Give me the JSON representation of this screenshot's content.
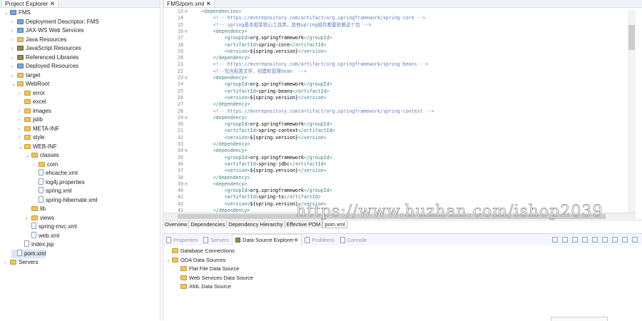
{
  "project_explorer": {
    "tab_label": "Project Explorer",
    "items": [
      {
        "label": "FMS",
        "depth": 0,
        "twisty": "open",
        "icon": "proj"
      },
      {
        "label": "Deployment Descriptor: FMS",
        "depth": 1,
        "twisty": "closed",
        "icon": "proj"
      },
      {
        "label": "JAX-WS Web Services",
        "depth": 1,
        "twisty": "closed",
        "icon": "proj"
      },
      {
        "label": "Java Resources",
        "depth": 1,
        "twisty": "closed",
        "icon": "folder"
      },
      {
        "label": "JavaScript Resources",
        "depth": 1,
        "twisty": "closed",
        "icon": "lib"
      },
      {
        "label": "Referenced Libraries",
        "depth": 1,
        "twisty": "closed",
        "icon": "lib"
      },
      {
        "label": "Deployed Resources",
        "depth": 1,
        "twisty": "closed",
        "icon": "proj"
      },
      {
        "label": "target",
        "depth": 1,
        "twisty": "closed",
        "icon": "folder"
      },
      {
        "label": "WebRoot",
        "depth": 1,
        "twisty": "open",
        "icon": "folder"
      },
      {
        "label": "error",
        "depth": 2,
        "twisty": "closed",
        "icon": "folder"
      },
      {
        "label": "excel",
        "depth": 2,
        "twisty": "",
        "icon": "folder"
      },
      {
        "label": "images",
        "depth": 2,
        "twisty": "closed",
        "icon": "folder"
      },
      {
        "label": "jslib",
        "depth": 2,
        "twisty": "closed",
        "icon": "folder"
      },
      {
        "label": "META-INF",
        "depth": 2,
        "twisty": "closed",
        "icon": "folder"
      },
      {
        "label": "style",
        "depth": 2,
        "twisty": "closed",
        "icon": "folder"
      },
      {
        "label": "WEB-INF",
        "depth": 2,
        "twisty": "open",
        "icon": "folder"
      },
      {
        "label": "classes",
        "depth": 3,
        "twisty": "open",
        "icon": "folder"
      },
      {
        "label": "com",
        "depth": 4,
        "twisty": "closed",
        "icon": "folder"
      },
      {
        "label": "ehcache.xml",
        "depth": 4,
        "twisty": "",
        "icon": "file"
      },
      {
        "label": "log4j.properties",
        "depth": 4,
        "twisty": "",
        "icon": "file"
      },
      {
        "label": "spring.xml",
        "depth": 4,
        "twisty": "",
        "icon": "file"
      },
      {
        "label": "spring-hibernate.xml",
        "depth": 4,
        "twisty": "",
        "icon": "file"
      },
      {
        "label": "lib",
        "depth": 3,
        "twisty": "",
        "icon": "folder"
      },
      {
        "label": "views",
        "depth": 3,
        "twisty": "closed",
        "icon": "folder"
      },
      {
        "label": "spring-mvc.xml",
        "depth": 3,
        "twisty": "",
        "icon": "file"
      },
      {
        "label": "web.xml",
        "depth": 3,
        "twisty": "",
        "icon": "file"
      },
      {
        "label": "index.jsp",
        "depth": 2,
        "twisty": "",
        "icon": "file"
      },
      {
        "label": "pom.xml",
        "depth": 1,
        "twisty": "",
        "icon": "file",
        "selected": true
      },
      {
        "label": "Servers",
        "depth": 0,
        "twisty": "closed",
        "icon": "folder"
      }
    ]
  },
  "editor": {
    "tab_label": "FMS/pom.xml",
    "lines": [
      {
        "n": "13",
        "fold": true,
        "indent": 1,
        "kind": "open",
        "tag": "dependencies"
      },
      {
        "n": "14",
        "indent": 2,
        "kind": "comment",
        "text": "<!-- https://mvnrepository.com/artifact/org.springframework/spring-core -->"
      },
      {
        "n": "15",
        "indent": 2,
        "kind": "comment",
        "text": "<!-- spring基本框架核心工具类，其他spring组件都要依赖这个包 -->"
      },
      {
        "n": "16",
        "fold": true,
        "indent": 2,
        "kind": "open",
        "tag": "dependency"
      },
      {
        "n": "17",
        "indent": 3,
        "kind": "elem",
        "tag": "groupId",
        "value": "org.springframework"
      },
      {
        "n": "18",
        "indent": 3,
        "kind": "elem",
        "tag": "artifactId",
        "value": "spring-core"
      },
      {
        "n": "19",
        "indent": 3,
        "kind": "elem",
        "tag": "version",
        "value": "${spring.version}"
      },
      {
        "n": "20",
        "indent": 2,
        "kind": "close",
        "tag": "dependency"
      },
      {
        "n": "21",
        "indent": 2,
        "kind": "comment",
        "text": "<!-- https://mvnrepository.com/artifact/org.springframework/spring-beans -->"
      },
      {
        "n": "22",
        "indent": 2,
        "kind": "comment",
        "text": "<!--包含配置文件，创建和管理bean  -->"
      },
      {
        "n": "23",
        "fold": true,
        "indent": 2,
        "kind": "open",
        "tag": "dependency"
      },
      {
        "n": "24",
        "indent": 3,
        "kind": "elem",
        "tag": "groupId",
        "value": "org.springframework"
      },
      {
        "n": "25",
        "indent": 3,
        "kind": "elem",
        "tag": "artifactId",
        "value": "spring-beans"
      },
      {
        "n": "26",
        "indent": 3,
        "kind": "elem",
        "tag": "version",
        "value": "${spring.version}"
      },
      {
        "n": "27",
        "indent": 2,
        "kind": "close",
        "tag": "dependency"
      },
      {
        "n": "28",
        "indent": 2,
        "kind": "comment",
        "text": "<!-- https://mvnrepository.com/artifact/org.springframework/spring-context -->"
      },
      {
        "n": "29",
        "fold": true,
        "indent": 2,
        "kind": "open",
        "tag": "dependency"
      },
      {
        "n": "30",
        "indent": 3,
        "kind": "elem",
        "tag": "groupId",
        "value": "org.springframework"
      },
      {
        "n": "31",
        "indent": 3,
        "kind": "elem",
        "tag": "artifactId",
        "value": "spring-context"
      },
      {
        "n": "32",
        "indent": 3,
        "kind": "elem",
        "tag": "version",
        "value": "${spring.version}"
      },
      {
        "n": "33",
        "indent": 2,
        "kind": "close",
        "tag": "dependency"
      },
      {
        "n": "34",
        "fold": true,
        "indent": 2,
        "kind": "open",
        "tag": "dependency"
      },
      {
        "n": "35",
        "indent": 3,
        "kind": "elem",
        "tag": "groupId",
        "value": "org.springframework"
      },
      {
        "n": "36",
        "indent": 3,
        "kind": "elem",
        "tag": "artifactId",
        "value": "spring-jdbc"
      },
      {
        "n": "37",
        "indent": 3,
        "kind": "elem",
        "tag": "version",
        "value": "${spring.version}"
      },
      {
        "n": "38",
        "indent": 2,
        "kind": "close",
        "tag": "dependency"
      },
      {
        "n": "39",
        "fold": true,
        "indent": 2,
        "kind": "open",
        "tag": "dependency"
      },
      {
        "n": "40",
        "indent": 3,
        "kind": "elem",
        "tag": "groupId",
        "value": "org.springframework"
      },
      {
        "n": "41",
        "indent": 3,
        "kind": "elem",
        "tag": "artifactId",
        "value": "spring-tx"
      },
      {
        "n": "42",
        "indent": 3,
        "kind": "elem",
        "tag": "version",
        "value": "${spring.version}"
      },
      {
        "n": "43",
        "indent": 2,
        "kind": "close",
        "tag": "dependency"
      }
    ],
    "bottom_tabs": [
      "Overview",
      "Dependencies",
      "Dependency Hierarchy",
      "Effective POM",
      "pom.xml"
    ],
    "active_tab": "pom.xml"
  },
  "bottom_panel": {
    "tabs": [
      {
        "label": "Properties",
        "active": false
      },
      {
        "label": "Servers",
        "active": false
      },
      {
        "label": "Data Source Explorer",
        "active": true
      },
      {
        "label": "Problems",
        "active": false
      },
      {
        "label": "Console",
        "active": false
      }
    ],
    "items": [
      {
        "label": "Database Connections",
        "depth": 0,
        "twisty": ""
      },
      {
        "label": "ODA Data Sources",
        "depth": 0,
        "twisty": "open"
      },
      {
        "label": "Flat File Data Source",
        "depth": 1,
        "twisty": ""
      },
      {
        "label": "Web Services Data Source",
        "depth": 1,
        "twisty": ""
      },
      {
        "label": "XML Data Source",
        "depth": 1,
        "twisty": ""
      }
    ]
  },
  "watermark": "https://www.huzhan.com/ishop2039"
}
